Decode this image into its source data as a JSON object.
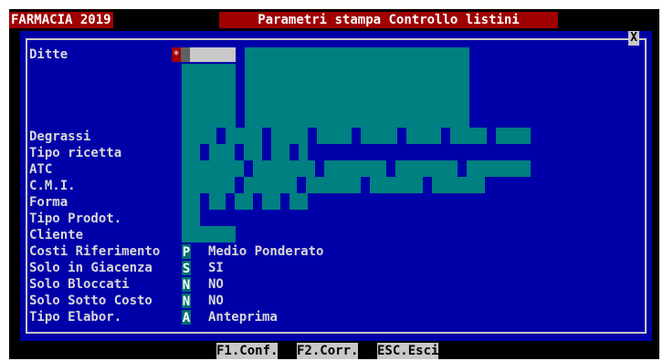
{
  "app_title": "FARMACIA 2019",
  "window_title": "Parametri stampa Controllo listini",
  "close_icon_glyph": "X",
  "fields": [
    {
      "label": "Ditte",
      "code": "*",
      "value": ""
    },
    {
      "label": "Degrassi",
      "code": "",
      "value": ""
    },
    {
      "label": "Tipo ricetta",
      "code": "",
      "value": ""
    },
    {
      "label": "ATC",
      "code": "",
      "value": ""
    },
    {
      "label": "C.M.I.",
      "code": "",
      "value": ""
    },
    {
      "label": "Forma",
      "code": "",
      "value": ""
    },
    {
      "label": "Tipo Prodot.",
      "code": "",
      "value": ""
    },
    {
      "label": "Cliente",
      "code": "",
      "value": ""
    },
    {
      "label": "Costi Riferimento",
      "code": "P",
      "value": "Medio Ponderato"
    },
    {
      "label": "Solo in Giacenza",
      "code": "S",
      "value": "SI"
    },
    {
      "label": "Solo Bloccati",
      "code": "N",
      "value": "NO"
    },
    {
      "label": "Solo Sotto Costo",
      "code": "N",
      "value": "NO"
    },
    {
      "label": "Tipo Elabor.",
      "code": "A",
      "value": "Anteprima"
    }
  ],
  "function_keys": [
    {
      "label": "F1.Conf."
    },
    {
      "label": "F2.Corr."
    },
    {
      "label": "ESC.Esci"
    }
  ],
  "colors": {
    "title_bar": "#a00000",
    "panel_background": "#0000a8",
    "field_teal": "#008080",
    "text": "#d8d8d8",
    "key_bar": "#c8c8c8"
  }
}
